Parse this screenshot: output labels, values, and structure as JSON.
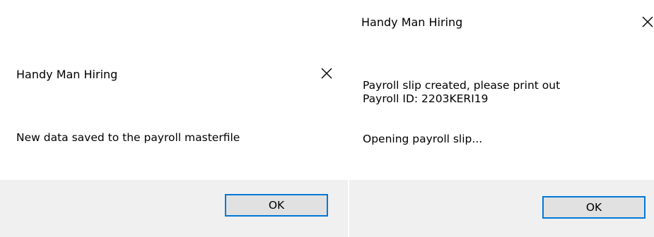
{
  "dialogs": [
    {
      "title": "Handy Man Hiring",
      "message_lines": [
        "New data saved to the payroll masterfile"
      ],
      "ok_label": "OK"
    },
    {
      "title": "Handy Man Hiring",
      "message_lines": [
        "Payroll slip created, please print out",
        "Payroll ID: 2203KERI19",
        "",
        "Opening payroll slip..."
      ],
      "ok_label": "OK"
    }
  ],
  "icons": {
    "close": "close-icon"
  },
  "colors": {
    "footer_bg": "#f0f0f0",
    "button_bg": "#e1e1e1",
    "button_border": "#0078d7"
  }
}
